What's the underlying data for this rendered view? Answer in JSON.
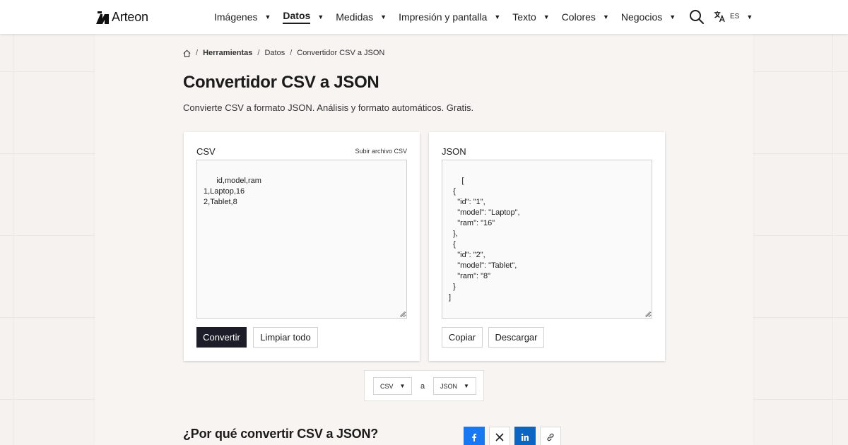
{
  "header": {
    "logo_text": "Arteon",
    "nav": [
      {
        "label": "Imágenes",
        "active": false
      },
      {
        "label": "Datos",
        "active": true
      },
      {
        "label": "Medidas",
        "active": false
      },
      {
        "label": "Impresión y pantalla",
        "active": false
      },
      {
        "label": "Texto",
        "active": false
      },
      {
        "label": "Colores",
        "active": false
      },
      {
        "label": "Negocios",
        "active": false
      }
    ],
    "language": "ES"
  },
  "breadcrumb": {
    "home_icon": "home-icon",
    "items": [
      "Herramientas",
      "Datos",
      "Convertidor CSV a JSON"
    ]
  },
  "page": {
    "title": "Convertidor CSV a JSON",
    "description": "Convierte CSV a formato JSON. Análisis y formato automáticos. Gratis."
  },
  "csv_panel": {
    "label": "CSV",
    "upload_link": "Subir archivo CSV",
    "input_value": "id,model,ram\n1,Laptop,16\n2,Tablet,8",
    "convert_button": "Convertir",
    "clear_button": "Limpiar todo"
  },
  "json_panel": {
    "label": "JSON",
    "output_value": "[\n  {\n    \"id\": \"1\",\n    \"model\": \"Laptop\",\n    \"ram\": \"16\"\n  },\n  {\n    \"id\": \"2\",\n    \"model\": \"Tablet\",\n    \"ram\": \"8\"\n  }\n]",
    "copy_button": "Copiar",
    "download_button": "Descargar"
  },
  "format_selector": {
    "from": "CSV",
    "separator": "a",
    "to": "JSON"
  },
  "why_section": {
    "title": "¿Por qué convertir CSV a JSON?"
  },
  "share": {
    "icons": [
      "facebook-icon",
      "x-icon",
      "linkedin-icon",
      "link-icon"
    ]
  },
  "colors": {
    "primary_button": "#1c1d29",
    "facebook": "#1877f2",
    "linkedin": "#0a66c2",
    "page_background": "#f5f2ef"
  }
}
